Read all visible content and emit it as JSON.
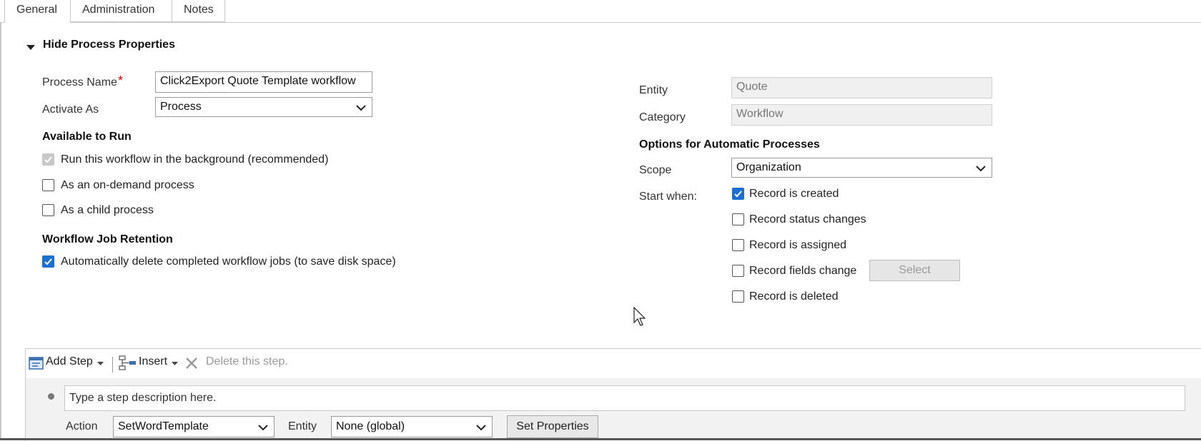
{
  "tabs": [
    {
      "label": "General"
    },
    {
      "label": "Administration"
    },
    {
      "label": "Notes"
    }
  ],
  "section": {
    "toggle_label": "Hide Process Properties"
  },
  "left": {
    "process_name_label": "Process Name",
    "required_marker": "*",
    "process_name_value": "Click2Export Quote Template workflow",
    "activate_as_label": "Activate As",
    "activate_as_value": "Process",
    "available_heading": "Available to Run",
    "options": [
      {
        "label": "Run this workflow in the background (recommended)",
        "checked": true,
        "disabled": true
      },
      {
        "label": "As an on-demand process",
        "checked": false
      },
      {
        "label": "As a child process",
        "checked": false
      }
    ],
    "retention_heading": "Workflow Job Retention",
    "retention_option": {
      "label": "Automatically delete completed workflow jobs (to save disk space)",
      "checked": true
    }
  },
  "right": {
    "entity_label": "Entity",
    "entity_value": "Quote",
    "category_label": "Category",
    "category_value": "Workflow",
    "options_heading": "Options for Automatic Processes",
    "scope_label": "Scope",
    "scope_value": "Organization",
    "start_when_label": "Start when:",
    "start_options": [
      {
        "label": "Record is created",
        "checked": true
      },
      {
        "label": "Record status changes",
        "checked": false
      },
      {
        "label": "Record is assigned",
        "checked": false
      },
      {
        "label": "Record fields change",
        "checked": false
      },
      {
        "label": "Record is deleted",
        "checked": false
      }
    ],
    "select_button": "Select"
  },
  "toolbar": {
    "add_step": "Add Step",
    "insert": "Insert",
    "delete": "Delete this step."
  },
  "step": {
    "description_placeholder": "Type a step description here.",
    "action_label": "Action",
    "action_value": "SetWordTemplate",
    "entity_label": "Entity",
    "entity_value": "None (global)",
    "set_properties": "Set Properties"
  },
  "colors": {
    "accent": "#1a6fd1",
    "required": "#d00000"
  }
}
